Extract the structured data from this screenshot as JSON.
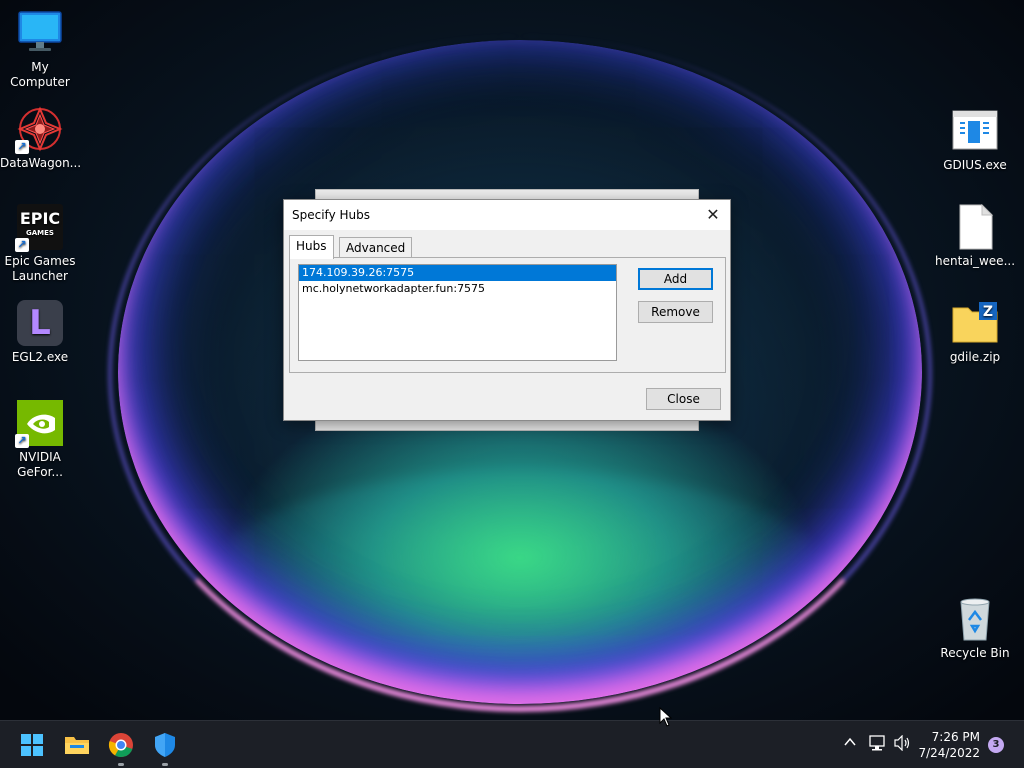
{
  "desktop": {
    "icons_left": [
      {
        "label": "My Computer",
        "icon": "computer-icon",
        "shortcut": false
      },
      {
        "label": "DataWagon...",
        "icon": "datawagon-icon",
        "shortcut": true
      },
      {
        "label": "Epic Games Launcher",
        "icon": "epic-games-icon",
        "shortcut": true,
        "logo_text": "EPIC",
        "logo_subtext": "GAMES"
      },
      {
        "label": "EGL2.exe",
        "icon": "egl2-icon",
        "shortcut": false,
        "logo_text": "L"
      },
      {
        "label": "NVIDIA GeFor...",
        "icon": "nvidia-icon",
        "shortcut": true
      }
    ],
    "icons_right": [
      {
        "label": "GDIUS.exe",
        "icon": "exe-file-icon"
      },
      {
        "label": "hentai_wee...",
        "icon": "blank-file-icon"
      },
      {
        "label": "gdile.zip",
        "icon": "zip-folder-icon"
      },
      {
        "label": "Recycle Bin",
        "icon": "recycle-bin-icon"
      }
    ]
  },
  "dialog": {
    "title": "Specify Hubs",
    "close_glyph": "✕",
    "tabs": [
      {
        "label": "Hubs",
        "active": true
      },
      {
        "label": "Advanced",
        "active": false
      }
    ],
    "hubs": [
      {
        "address": "174.109.39.26:7575",
        "selected": true
      },
      {
        "address": "mc.holynetworkadapter.fun:7575",
        "selected": false
      }
    ],
    "add_label": "Add",
    "remove_label": "Remove",
    "close_label": "Close"
  },
  "taskbar": {
    "apps": [
      {
        "name": "start",
        "icon": "windows-start-icon",
        "running": false
      },
      {
        "name": "file-explorer",
        "icon": "folder-icon",
        "running": false
      },
      {
        "name": "chrome",
        "icon": "chrome-icon",
        "running": true
      },
      {
        "name": "security",
        "icon": "shield-icon",
        "running": true
      }
    ],
    "tray": {
      "chevron": "^",
      "time": "7:26 PM",
      "date": "7/24/2022",
      "notification_count": "3"
    }
  },
  "colors": {
    "accent": "#0078d7",
    "taskbar": "#1c1f26"
  }
}
